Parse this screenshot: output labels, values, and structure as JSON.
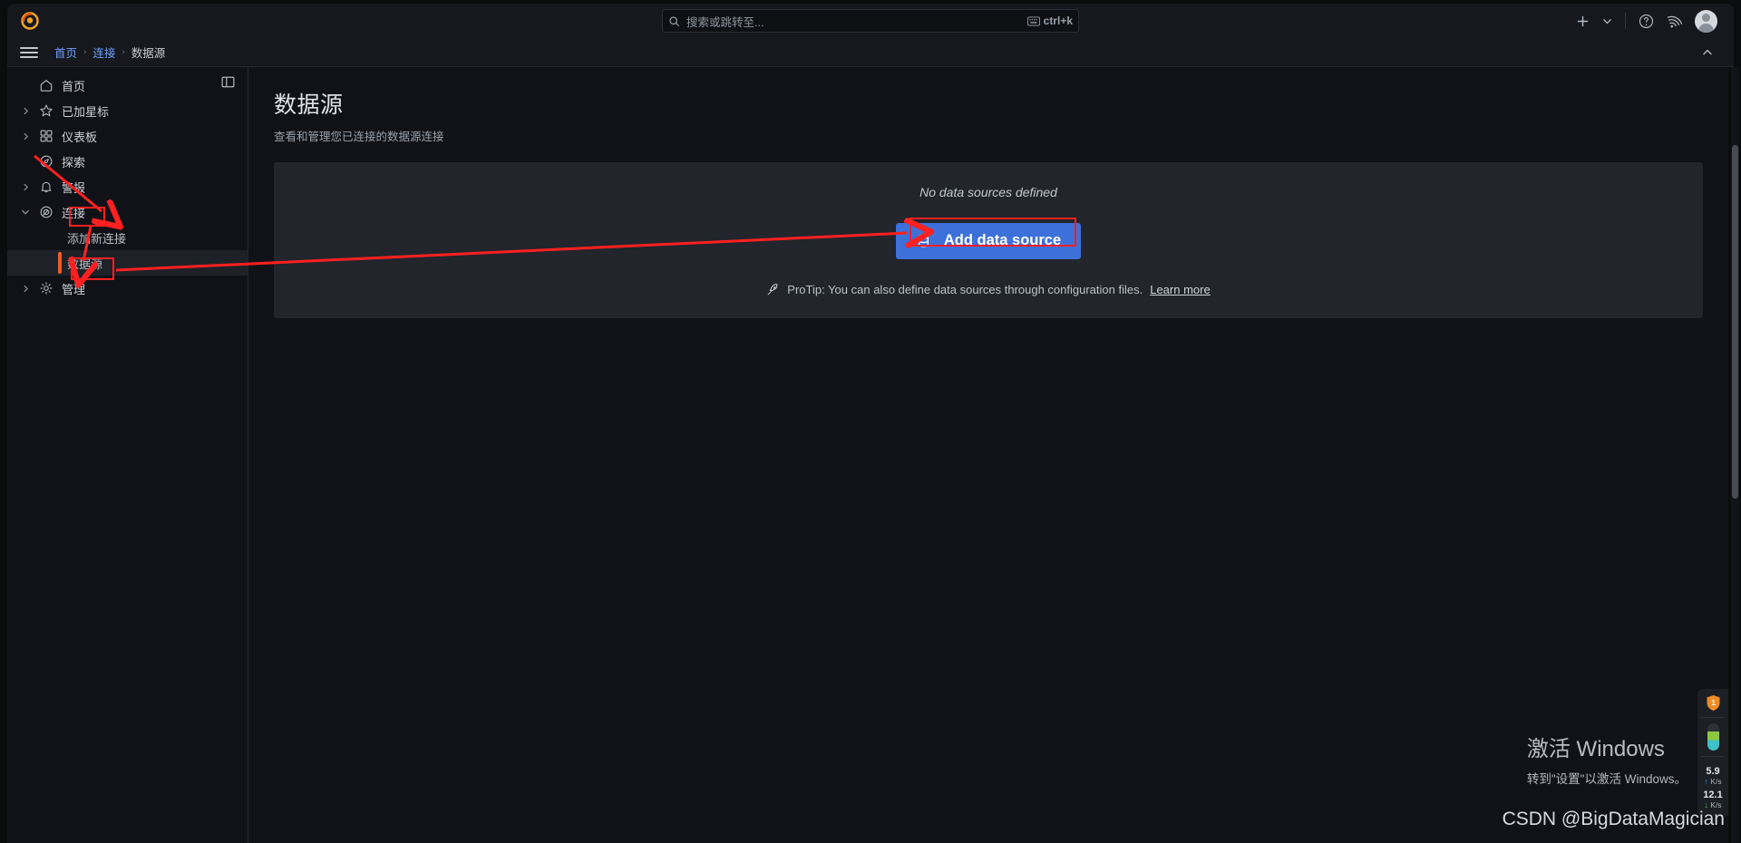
{
  "app": {
    "brand": "grafana-logo"
  },
  "topbar": {
    "search": {
      "placeholder": "搜索或跳转至...",
      "shortcut": "ctrl+k",
      "icon": "search-icon",
      "kbd_icon": "keyboard-icon"
    },
    "actions": [
      {
        "name": "add-menu",
        "icon": "plus-icon",
        "label": "+"
      },
      {
        "name": "add-menu-caret",
        "icon": "chevron-down-icon",
        "label": "⌄"
      },
      {
        "name": "help",
        "icon": "help-circle-icon",
        "label": "?"
      },
      {
        "name": "news",
        "icon": "rss-icon",
        "label": "rss"
      },
      {
        "name": "profile",
        "icon": "avatar-icon",
        "label": ""
      }
    ]
  },
  "breadcrumb": {
    "menu_icon": "hamburger-icon",
    "items": [
      {
        "label": "首页",
        "current": false
      },
      {
        "label": "连接",
        "current": false
      },
      {
        "label": "数据源",
        "current": true
      }
    ],
    "separator": "›",
    "collapse_icon": "chevron-up-icon"
  },
  "sidebar": {
    "dock_icon": "dock-panel-icon",
    "items": [
      {
        "label": "首页",
        "icon": "home-icon",
        "expandable": false,
        "active": false,
        "child": false
      },
      {
        "label": "已加星标",
        "icon": "star-icon",
        "expandable": true,
        "expanded": false,
        "active": false,
        "child": false
      },
      {
        "label": "仪表板",
        "icon": "dashboards-icon",
        "expandable": true,
        "expanded": false,
        "active": false,
        "child": false
      },
      {
        "label": "探索",
        "icon": "compass-icon",
        "expandable": false,
        "active": false,
        "child": false
      },
      {
        "label": "警报",
        "icon": "bell-icon",
        "expandable": true,
        "expanded": false,
        "active": false,
        "child": false
      },
      {
        "label": "连接",
        "icon": "connections-icon",
        "expandable": true,
        "expanded": true,
        "active": false,
        "child": false
      },
      {
        "label": "添加新连接",
        "icon": "",
        "expandable": false,
        "active": false,
        "child": true
      },
      {
        "label": "数据源",
        "icon": "",
        "expandable": false,
        "active": true,
        "child": true
      },
      {
        "label": "管理",
        "icon": "gear-icon",
        "expandable": true,
        "expanded": false,
        "active": false,
        "child": false
      }
    ]
  },
  "page": {
    "title": "数据源",
    "subtitle": "查看和管理您已连接的数据源连接"
  },
  "panel": {
    "empty_text": "No data sources defined",
    "add_button": {
      "label": "Add data source",
      "icon": "database-icon"
    },
    "protip": {
      "icon": "rocket-icon",
      "text": "ProTip: You can also define data sources through configuration files.",
      "link": "Learn more"
    }
  },
  "net_widget": {
    "shield_badge": "1",
    "upload": {
      "value": "5.9",
      "unit": "K/s",
      "arrow": "↑"
    },
    "download": {
      "value": "12.1",
      "unit": "K/s",
      "arrow": "↓"
    }
  },
  "watermark": {
    "windows_title": "激活 Windows",
    "windows_sub": "转到\"设置\"以激活 Windows。",
    "csdn": "CSDN @BigDataMagician"
  },
  "colors": {
    "accent_blue": "#3d71d9",
    "active_orange": "#f05a28",
    "link_blue": "#6e9fff",
    "annotation_red": "#ff2020",
    "panel_bg": "#22252b",
    "page_bg": "#111217"
  }
}
